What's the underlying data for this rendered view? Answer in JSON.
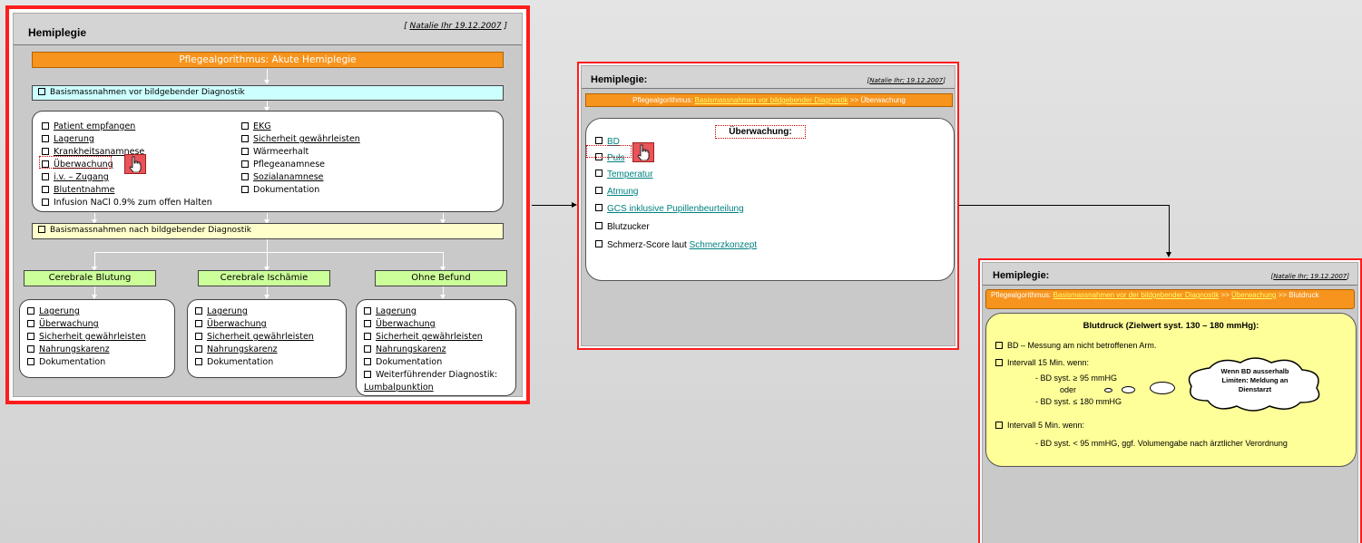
{
  "panel1": {
    "title": "Hemiplegie",
    "author_prefix": "[ ",
    "author": "Natalie Ihr 19.12.2007",
    "author_suffix": " ]",
    "algorithm_header": "Pflegealgorithmus: Akute Hemiplegie",
    "before_imaging": "Basismassnahmen vor bildgebender Diagnostik",
    "before_left": [
      {
        "label": "Patient empfangen",
        "link": true
      },
      {
        "label": "Lagerung",
        "link": true
      },
      {
        "label": "Krankheitsanamnese",
        "link": true
      },
      {
        "label": "Überwachung",
        "link": true
      },
      {
        "label": "i.v. – Zugang",
        "link": true
      },
      {
        "label": "Blutentnahme",
        "link": true
      },
      {
        "label": "Infusion NaCl 0.9% zum offen Halten",
        "link": false
      }
    ],
    "before_right": [
      {
        "label": "EKG",
        "link": true
      },
      {
        "label": "Sicherheit gewährleisten",
        "link": true
      },
      {
        "label": "Wärmeerhalt",
        "link": false
      },
      {
        "label": "Pflegeanamnese",
        "link": false
      },
      {
        "label": "Sozialanamnese",
        "link": true
      },
      {
        "label": "Dokumentation",
        "link": false
      }
    ],
    "after_imaging": "Basismassnahmen nach bildgebender Diagnostik",
    "branches": [
      {
        "label": "Cerebrale Blutung",
        "items": [
          "Lagerung",
          "Überwachung",
          "Sicherheit gewährleisten",
          "Nahrungskarenz",
          "Dokumentation"
        ],
        "links": [
          true,
          true,
          true,
          true,
          false
        ]
      },
      {
        "label": "Cerebrale Ischämie",
        "items": [
          "Lagerung",
          "Überwachung",
          "Sicherheit gewährleisten",
          "Nahrungskarenz",
          "Dokumentation"
        ],
        "links": [
          true,
          true,
          true,
          true,
          false
        ]
      },
      {
        "label": "Ohne Befund",
        "items": [
          "Lagerung",
          "Überwachung",
          "Sicherheit gewährleisten",
          "Nahrungskarenz",
          "Dokumentation",
          "Weiterführender Diagnostik:",
          "Lumbalpunktion"
        ],
        "links": [
          true,
          true,
          true,
          true,
          false,
          false,
          true
        ]
      }
    ]
  },
  "panel2": {
    "title": "Hemiplegie:",
    "author_prefix": "[",
    "author": "Natalie Ihr; 19.12.2007",
    "author_suffix": "]",
    "crumb_prefix": "Pflegealgorithmus: ",
    "crumb_link": "Basismassnahmen vor bildgebender Diagnostik",
    "crumb_sep": " >> ",
    "crumb_current": "Überwachung",
    "heading": "Überwachung:",
    "items": [
      {
        "label": "BD",
        "link": true
      },
      {
        "label": "Puls",
        "link": true
      },
      {
        "label": "Temperatur",
        "link": true
      },
      {
        "label": "Atmung",
        "link": true
      },
      {
        "label": "GCS inklusive Pupillenbeurteilung",
        "link": true
      },
      {
        "label": "Blutzucker",
        "link": false
      }
    ],
    "last_item_text": "Schmerz-Score laut ",
    "last_item_link": "Schmerzkonzept"
  },
  "panel3": {
    "title": "Hemiplegie:",
    "author_prefix": "[",
    "author": "Natalie Ihr; 19.12.2007",
    "author_suffix": "]",
    "crumb_prefix": "Pflegealgorithmus: ",
    "crumb_link1": "Basismassnahmen vor der bildgebender Diagnostik",
    "crumb_sep": " >> ",
    "crumb_link2": "Überwachung",
    "crumb_current": "Blutdruck",
    "heading": "Blutdruck (Zielwert syst. 130 – 180 mmHg):",
    "line1": "BD – Messung am nicht betroffenen Arm.",
    "line2": "Intervall 15 Min. wenn:",
    "sub1": "- BD syst. ≥ 95 mmHG",
    "sub2": "oder",
    "sub3": "- BD syst. ≤ 180 mmHG",
    "cloud": "Wenn BD ausserhalb Limiten: Meldung an Dienstarzt",
    "line3": "Intervall 5 Min. wenn:",
    "sub4": "- BD syst. < 95 mmHG, ggf. Volumengabe nach ärztlicher Verordnung"
  }
}
